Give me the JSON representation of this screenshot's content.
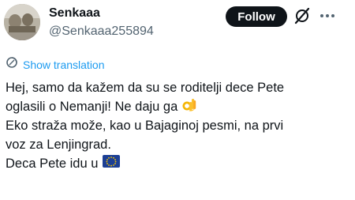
{
  "author": {
    "display_name": "Senkaaa",
    "handle": "@Senkaaa255894"
  },
  "actions": {
    "follow_label": "Follow",
    "grok_icon": "grok-icon",
    "more_icon": "more-dots-icon"
  },
  "translation": {
    "label": "Show translation",
    "icon": "translate-icon"
  },
  "tweet": {
    "lines": [
      "Hej, samo da kažem da su  se roditelji dece Pete",
      "oglasili o Nemanji! Ne daju ga",
      "Eko straža može, kao u Bajaginoj pesmi, na prvi",
      "voz za Lenjingrad.",
      "Deca Pete idu u"
    ],
    "emojis": {
      "line2": "ok-hand-emoji",
      "line5": "eu-flag-emoji"
    }
  },
  "colors": {
    "text": "#0f1419",
    "secondary": "#536471",
    "link": "#1d9bf0",
    "follow_bg": "#0f1419"
  }
}
